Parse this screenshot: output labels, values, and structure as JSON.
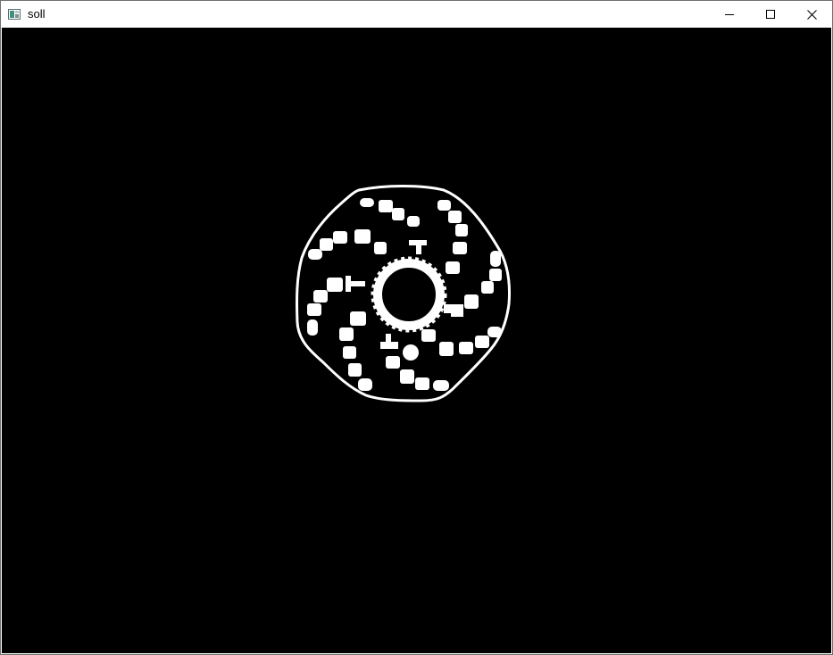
{
  "window": {
    "title": "soll",
    "app_icon": "image-window-icon",
    "controls": {
      "minimize_icon": "minimize-icon",
      "maximize_icon": "maximize-icon",
      "close_icon": "close-icon"
    }
  },
  "canvas": {
    "background": "#000000",
    "foreground": "#ffffff"
  }
}
